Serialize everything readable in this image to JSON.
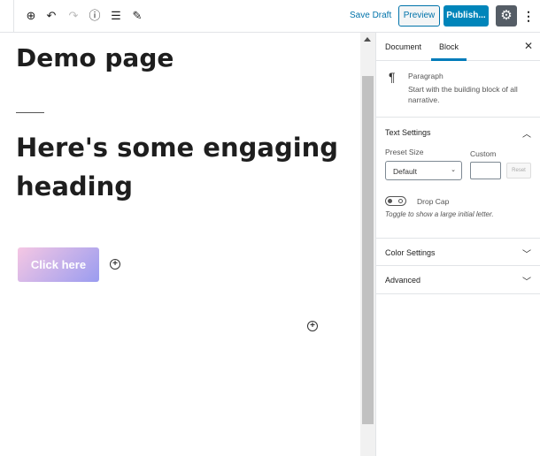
{
  "toolbar": {
    "save_draft": "Save Draft",
    "preview": "Preview",
    "publish": "Publish...",
    "icons": [
      "add-block-icon",
      "undo-icon",
      "redo-icon",
      "info-icon",
      "outline-icon",
      "edit-icon",
      "gear-icon",
      "more-icon"
    ]
  },
  "editor": {
    "title": "Demo page",
    "heading": "Here's some engaging heading",
    "button_label": "Click here",
    "button_gradient": [
      "#f5c7e3",
      "#9a9cf0"
    ]
  },
  "sidebar": {
    "tabs": [
      {
        "label": "Document"
      },
      {
        "label": "Block"
      }
    ],
    "active_tab": "Block",
    "block": {
      "name": "Paragraph",
      "description": "Start with the building block of all narrative."
    },
    "text_settings": {
      "title": "Text Settings",
      "preset_label": "Preset Size",
      "preset_value": "Default",
      "custom_label": "Custom",
      "reset": "Reset",
      "drop_cap": "Drop Cap",
      "drop_cap_help": "Toggle to show a large initial letter.",
      "drop_cap_on": false
    },
    "color_settings": "Color Settings",
    "advanced": "Advanced"
  },
  "colors": {
    "accent": "#0085ba",
    "link": "#0073aa"
  }
}
